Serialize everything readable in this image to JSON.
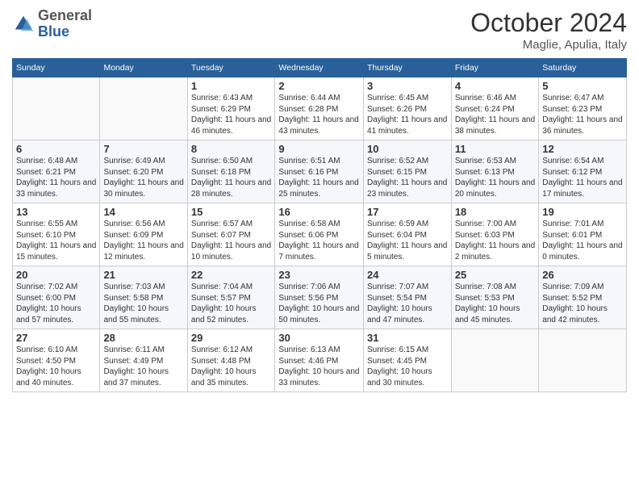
{
  "logo": {
    "general": "General",
    "blue": "Blue"
  },
  "header": {
    "month": "October 2024",
    "location": "Maglie, Apulia, Italy"
  },
  "weekdays": [
    "Sunday",
    "Monday",
    "Tuesday",
    "Wednesday",
    "Thursday",
    "Friday",
    "Saturday"
  ],
  "weeks": [
    [
      {
        "day": "",
        "info": ""
      },
      {
        "day": "",
        "info": ""
      },
      {
        "day": "1",
        "info": "Sunrise: 6:43 AM\nSunset: 6:29 PM\nDaylight: 11 hours and 46 minutes."
      },
      {
        "day": "2",
        "info": "Sunrise: 6:44 AM\nSunset: 6:28 PM\nDaylight: 11 hours and 43 minutes."
      },
      {
        "day": "3",
        "info": "Sunrise: 6:45 AM\nSunset: 6:26 PM\nDaylight: 11 hours and 41 minutes."
      },
      {
        "day": "4",
        "info": "Sunrise: 6:46 AM\nSunset: 6:24 PM\nDaylight: 11 hours and 38 minutes."
      },
      {
        "day": "5",
        "info": "Sunrise: 6:47 AM\nSunset: 6:23 PM\nDaylight: 11 hours and 36 minutes."
      }
    ],
    [
      {
        "day": "6",
        "info": "Sunrise: 6:48 AM\nSunset: 6:21 PM\nDaylight: 11 hours and 33 minutes."
      },
      {
        "day": "7",
        "info": "Sunrise: 6:49 AM\nSunset: 6:20 PM\nDaylight: 11 hours and 30 minutes."
      },
      {
        "day": "8",
        "info": "Sunrise: 6:50 AM\nSunset: 6:18 PM\nDaylight: 11 hours and 28 minutes."
      },
      {
        "day": "9",
        "info": "Sunrise: 6:51 AM\nSunset: 6:16 PM\nDaylight: 11 hours and 25 minutes."
      },
      {
        "day": "10",
        "info": "Sunrise: 6:52 AM\nSunset: 6:15 PM\nDaylight: 11 hours and 23 minutes."
      },
      {
        "day": "11",
        "info": "Sunrise: 6:53 AM\nSunset: 6:13 PM\nDaylight: 11 hours and 20 minutes."
      },
      {
        "day": "12",
        "info": "Sunrise: 6:54 AM\nSunset: 6:12 PM\nDaylight: 11 hours and 17 minutes."
      }
    ],
    [
      {
        "day": "13",
        "info": "Sunrise: 6:55 AM\nSunset: 6:10 PM\nDaylight: 11 hours and 15 minutes."
      },
      {
        "day": "14",
        "info": "Sunrise: 6:56 AM\nSunset: 6:09 PM\nDaylight: 11 hours and 12 minutes."
      },
      {
        "day": "15",
        "info": "Sunrise: 6:57 AM\nSunset: 6:07 PM\nDaylight: 11 hours and 10 minutes."
      },
      {
        "day": "16",
        "info": "Sunrise: 6:58 AM\nSunset: 6:06 PM\nDaylight: 11 hours and 7 minutes."
      },
      {
        "day": "17",
        "info": "Sunrise: 6:59 AM\nSunset: 6:04 PM\nDaylight: 11 hours and 5 minutes."
      },
      {
        "day": "18",
        "info": "Sunrise: 7:00 AM\nSunset: 6:03 PM\nDaylight: 11 hours and 2 minutes."
      },
      {
        "day": "19",
        "info": "Sunrise: 7:01 AM\nSunset: 6:01 PM\nDaylight: 11 hours and 0 minutes."
      }
    ],
    [
      {
        "day": "20",
        "info": "Sunrise: 7:02 AM\nSunset: 6:00 PM\nDaylight: 10 hours and 57 minutes."
      },
      {
        "day": "21",
        "info": "Sunrise: 7:03 AM\nSunset: 5:58 PM\nDaylight: 10 hours and 55 minutes."
      },
      {
        "day": "22",
        "info": "Sunrise: 7:04 AM\nSunset: 5:57 PM\nDaylight: 10 hours and 52 minutes."
      },
      {
        "day": "23",
        "info": "Sunrise: 7:06 AM\nSunset: 5:56 PM\nDaylight: 10 hours and 50 minutes."
      },
      {
        "day": "24",
        "info": "Sunrise: 7:07 AM\nSunset: 5:54 PM\nDaylight: 10 hours and 47 minutes."
      },
      {
        "day": "25",
        "info": "Sunrise: 7:08 AM\nSunset: 5:53 PM\nDaylight: 10 hours and 45 minutes."
      },
      {
        "day": "26",
        "info": "Sunrise: 7:09 AM\nSunset: 5:52 PM\nDaylight: 10 hours and 42 minutes."
      }
    ],
    [
      {
        "day": "27",
        "info": "Sunrise: 6:10 AM\nSunset: 4:50 PM\nDaylight: 10 hours and 40 minutes."
      },
      {
        "day": "28",
        "info": "Sunrise: 6:11 AM\nSunset: 4:49 PM\nDaylight: 10 hours and 37 minutes."
      },
      {
        "day": "29",
        "info": "Sunrise: 6:12 AM\nSunset: 4:48 PM\nDaylight: 10 hours and 35 minutes."
      },
      {
        "day": "30",
        "info": "Sunrise: 6:13 AM\nSunset: 4:46 PM\nDaylight: 10 hours and 33 minutes."
      },
      {
        "day": "31",
        "info": "Sunrise: 6:15 AM\nSunset: 4:45 PM\nDaylight: 10 hours and 30 minutes."
      },
      {
        "day": "",
        "info": ""
      },
      {
        "day": "",
        "info": ""
      }
    ]
  ]
}
